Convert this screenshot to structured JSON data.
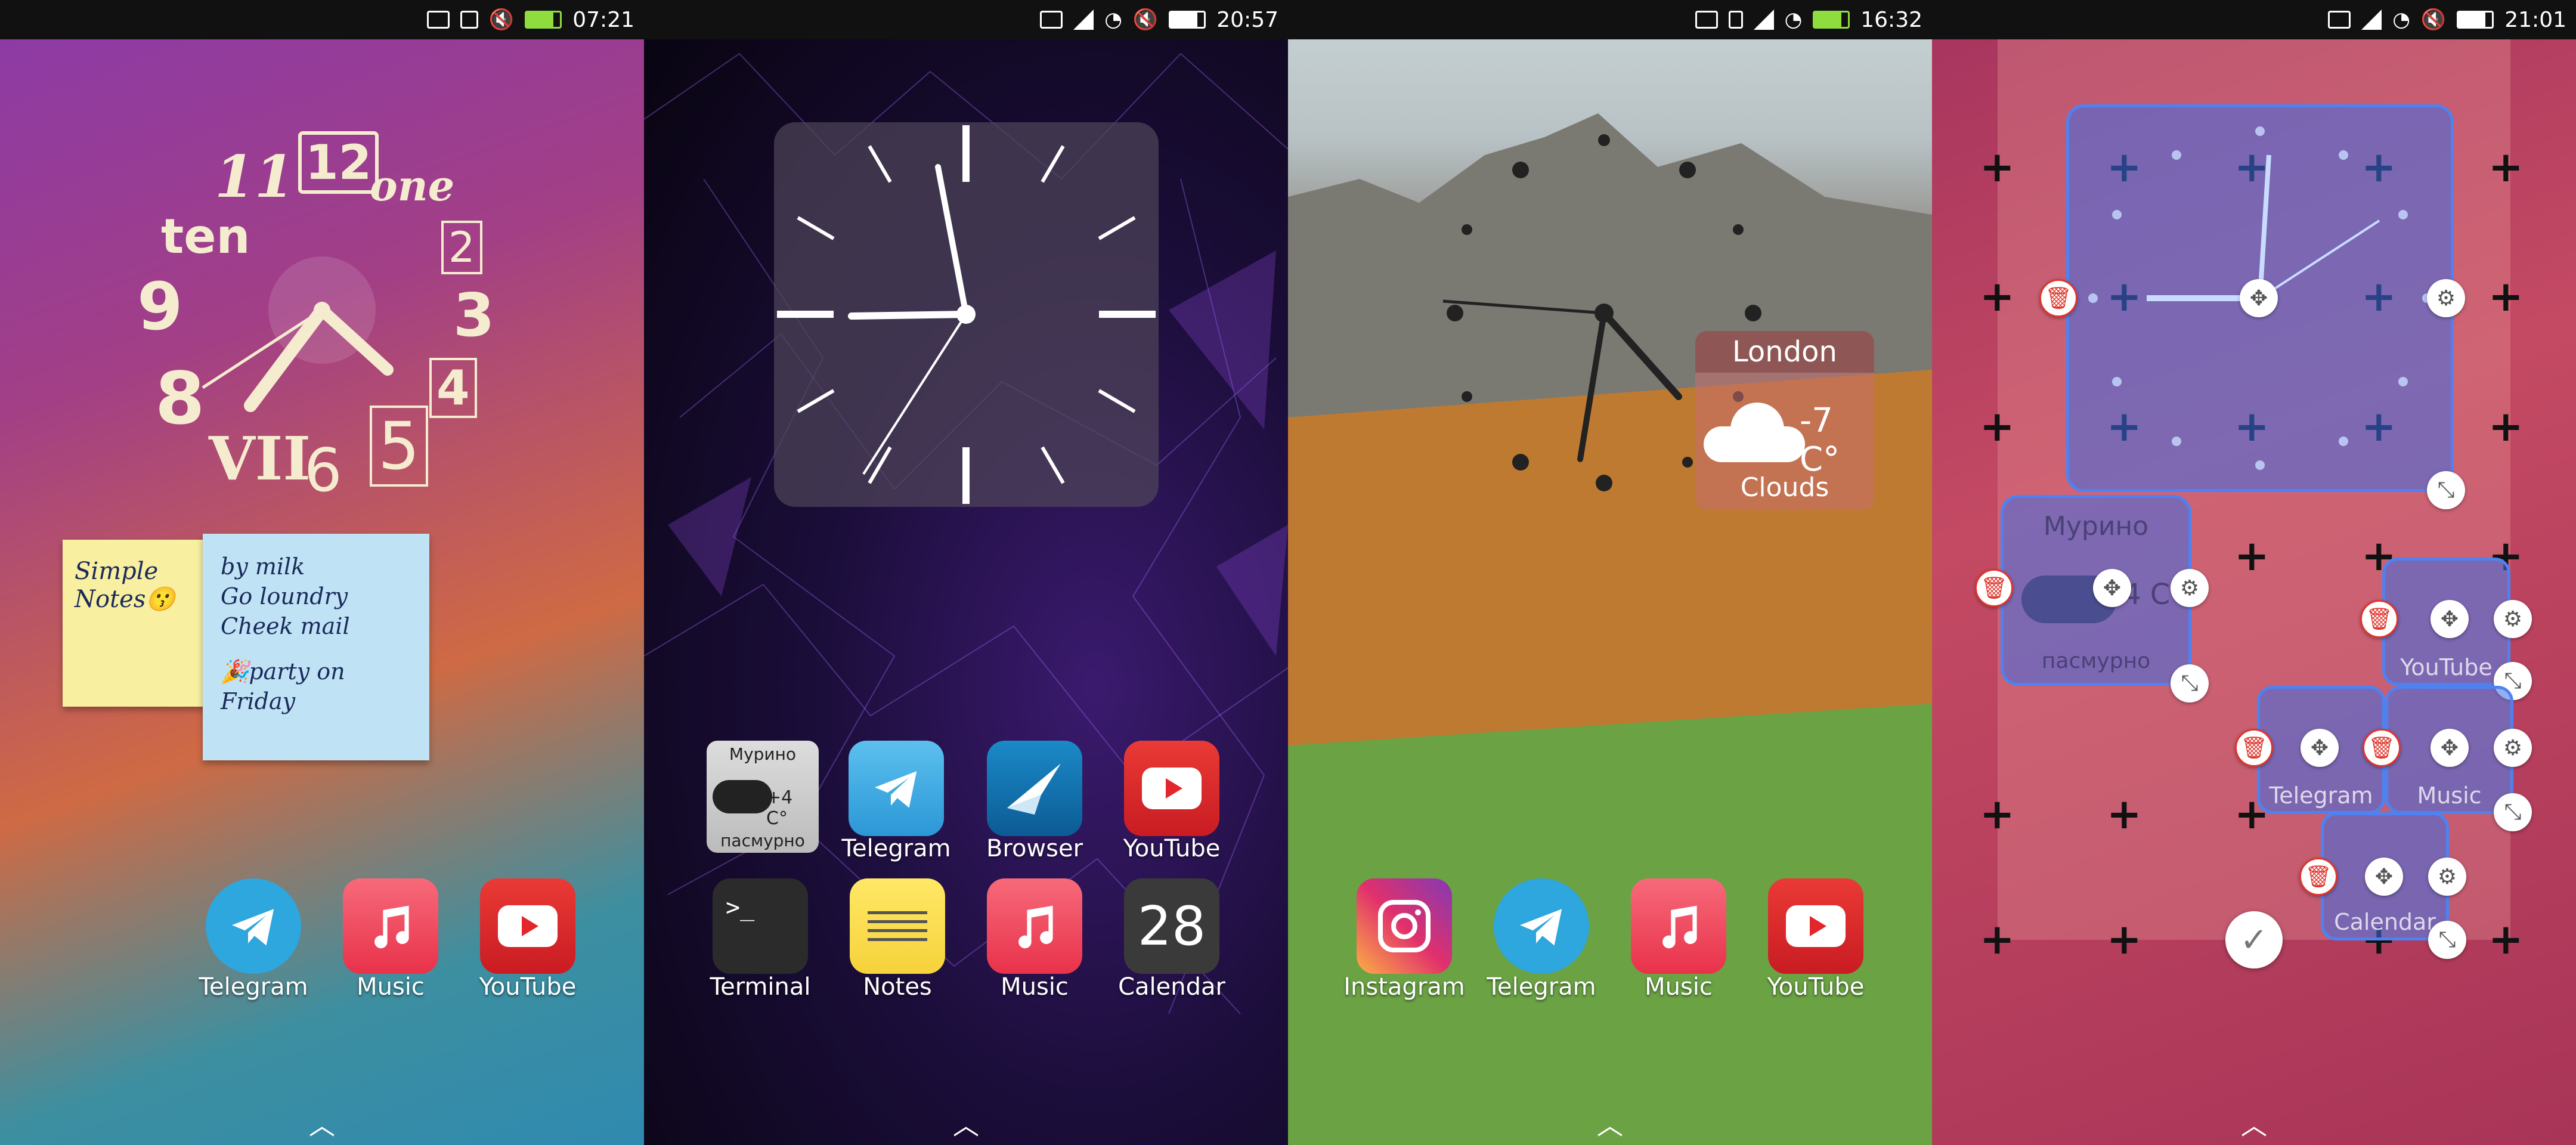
{
  "screens": [
    {
      "status": {
        "time": "07:21"
      },
      "clock_numerals": [
        "11",
        "12",
        "one",
        "ten",
        "2",
        "9",
        "3",
        "8",
        "4",
        "VII",
        "6",
        "5"
      ],
      "note": {
        "left_lines": [
          "Simple",
          "Notes😗"
        ],
        "right_lines": [
          "by milk",
          "Go loundry",
          "Cheek mail",
          "🎉party on",
          "Friday"
        ]
      },
      "dock": [
        {
          "label": "Telegram",
          "icon": "telegram-icon"
        },
        {
          "label": "Music",
          "icon": "music-icon"
        },
        {
          "label": "YouTube",
          "icon": "youtube-icon"
        }
      ]
    },
    {
      "status": {
        "time": "20:57"
      },
      "weather_widget": {
        "city": "Мурино",
        "temp": "+4 C°",
        "condition": "пасмурно"
      },
      "apps_row1": [
        {
          "label": "Telegram",
          "icon": "telegram-icon"
        },
        {
          "label": "Browser",
          "icon": "browser-icon"
        },
        {
          "label": "YouTube",
          "icon": "youtube-icon"
        }
      ],
      "apps_row2": [
        {
          "label": "Terminal",
          "icon": "terminal-icon",
          "glyph": ">_"
        },
        {
          "label": "Notes",
          "icon": "notes-icon"
        },
        {
          "label": "Music",
          "icon": "music-icon"
        },
        {
          "label": "Calendar",
          "icon": "calendar-icon",
          "glyph": "28"
        }
      ]
    },
    {
      "status": {
        "time": "16:32"
      },
      "weather": {
        "city": "London",
        "temp": "-7 C°",
        "condition": "Clouds"
      },
      "dock": [
        {
          "label": "Instagram",
          "icon": "instagram-icon"
        },
        {
          "label": "Telegram",
          "icon": "telegram-icon"
        },
        {
          "label": "Music",
          "icon": "music-icon"
        },
        {
          "label": "YouTube",
          "icon": "youtube-icon"
        }
      ]
    },
    {
      "status": {
        "time": "21:01"
      },
      "weather_widget": {
        "city": "Мурино",
        "temp": "4 C",
        "condition": "пасмурно"
      },
      "edit_labels": [
        "YouTube",
        "Telegram",
        "Music",
        "Calendar"
      ]
    }
  ],
  "colors": {
    "telegram": "#2ea6de",
    "music": "#f0485a",
    "youtube": "#e3262b",
    "instagram": "#c13584",
    "edit_highlight": "#4f82f0",
    "delete": "#e0352b"
  }
}
